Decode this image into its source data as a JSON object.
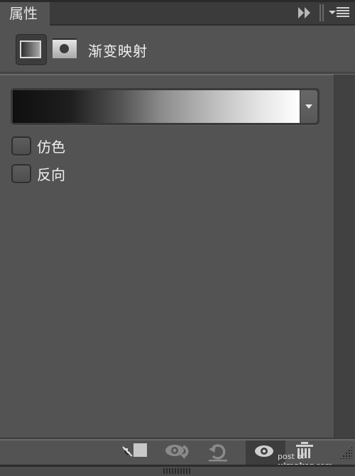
{
  "panel": {
    "tab_label": "属性",
    "header_title": "渐变映射",
    "icons": {
      "collapse": "double-chevron-right-icon",
      "menu": "panel-menu-icon",
      "adjustment_mode": "gradient-map-adjustment-icon",
      "mask_mode": "layer-mask-icon"
    }
  },
  "gradient": {
    "stops": [
      "#0f0f0f",
      "#ffffff"
    ],
    "dropdown_icon": "chevron-down-icon"
  },
  "options": [
    {
      "label": "仿色",
      "checked": false
    },
    {
      "label": "反向",
      "checked": false
    }
  ],
  "footer": {
    "buttons": [
      {
        "name": "clip-to-layer",
        "icon": "clip-to-layer-icon"
      },
      {
        "name": "view-previous-state",
        "icon": "eye-previous-icon"
      },
      {
        "name": "reset",
        "icon": "reset-icon"
      },
      {
        "name": "toggle-visibility",
        "icon": "eye-icon",
        "active": true
      },
      {
        "name": "delete",
        "icon": "trash-icon"
      }
    ],
    "watermark": {
      "prefix": "post of ",
      "bold": "uimaker",
      "suffix": ".com"
    }
  }
}
